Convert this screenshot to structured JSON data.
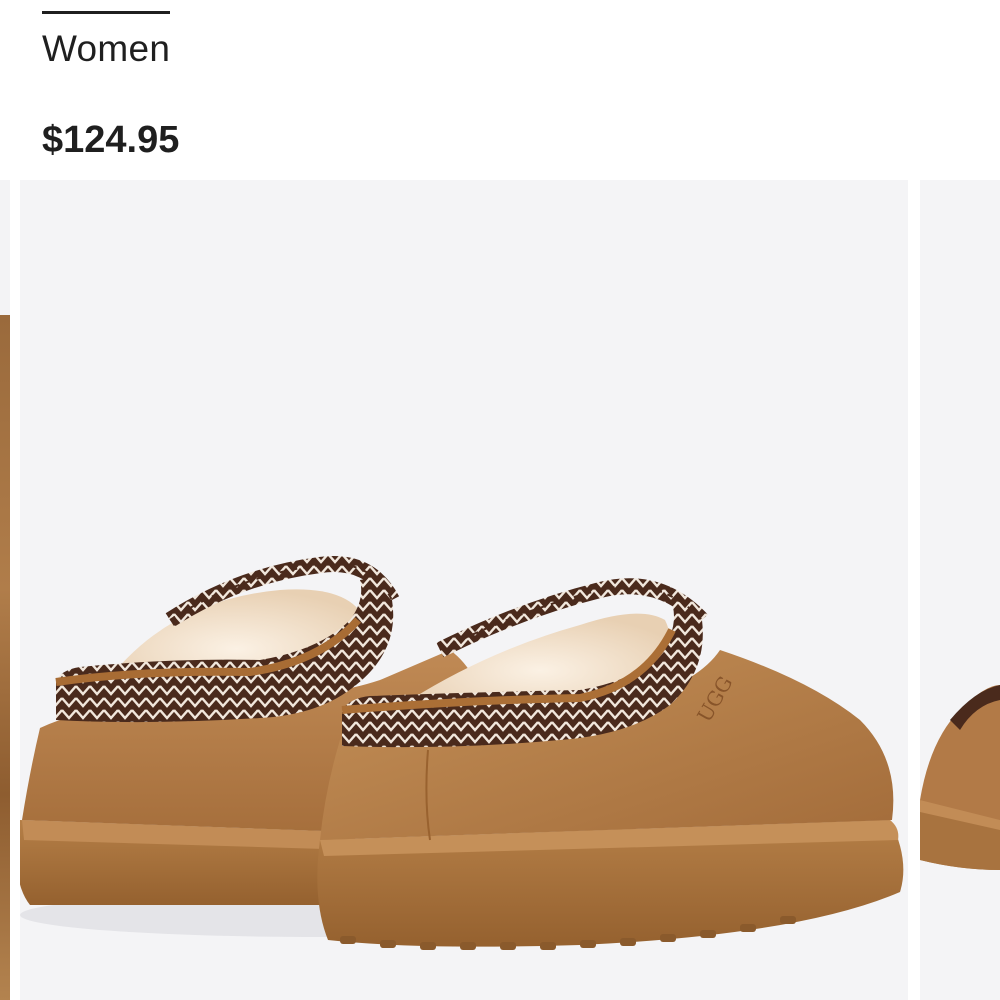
{
  "product": {
    "category": "Women",
    "price": "$124.95"
  },
  "gallery": {
    "main_image": {
      "subject": "chestnut suede slippers with embroidered braided collar",
      "logo_text": "UGG"
    },
    "colors": {
      "background": "#f4f4f6",
      "suede": "#b27a47",
      "sole": "#a8733f",
      "braid_dark": "#4a2a1c",
      "fleece": "#f3e2cf"
    }
  }
}
